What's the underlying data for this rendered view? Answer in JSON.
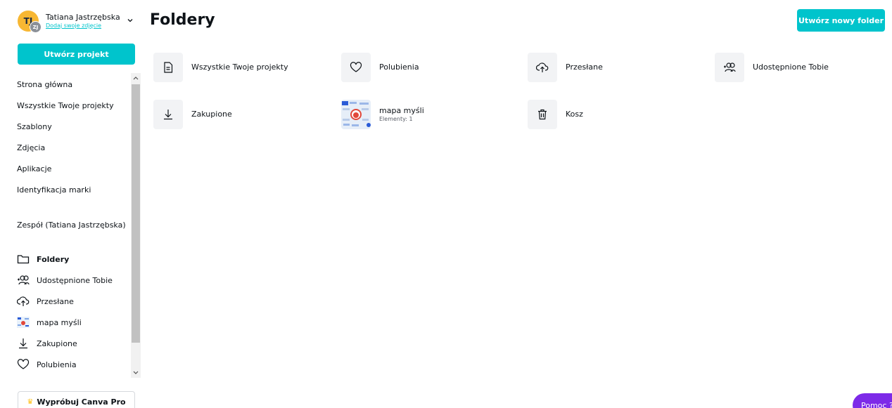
{
  "user": {
    "name": "Tatiana Jastrzębska",
    "add_photo_link": "Dodaj swoje zdjęcie",
    "avatar_initials": "TJ",
    "team_badge": "ZJ",
    "avatar_color": "#f7b733"
  },
  "sidebar": {
    "create_button": "Utwórz projekt",
    "items": [
      {
        "label": "Strona główna"
      },
      {
        "label": "Wszystkie Twoje projekty"
      },
      {
        "label": "Szablony"
      },
      {
        "label": "Zdjęcia"
      },
      {
        "label": "Aplikacje"
      },
      {
        "label": "Identyfikacja marki"
      },
      {
        "label": "Zespół (Tatiana Jastrzębska)"
      }
    ],
    "folders": [
      {
        "label": "Foldery",
        "icon": "folder-icon",
        "active": true
      },
      {
        "label": "Udostępnione Tobie",
        "icon": "shared-users-icon"
      },
      {
        "label": "Przesłane",
        "icon": "cloud-upload-icon"
      },
      {
        "label": "mapa myśli",
        "icon": "mind-map-thumbnail"
      },
      {
        "label": "Zakupione",
        "icon": "download-icon"
      },
      {
        "label": "Polubienia",
        "icon": "heart-icon"
      }
    ],
    "pro_button": "Wypróbuj Canva Pro"
  },
  "main": {
    "title": "Foldery",
    "new_folder_button": "Utwórz nowy folder",
    "folders": [
      {
        "name": "Wszystkie Twoje projekty",
        "icon": "document-icon"
      },
      {
        "name": "Polubienia",
        "icon": "heart-icon"
      },
      {
        "name": "Przesłane",
        "icon": "cloud-upload-icon"
      },
      {
        "name": "Udostępnione Tobie",
        "icon": "shared-users-icon"
      },
      {
        "name": "Zakupione",
        "icon": "download-icon"
      },
      {
        "name": "mapa myśli",
        "subtitle": "Elementy: 1",
        "icon": "mind-map-thumbnail"
      },
      {
        "name": "Kosz",
        "icon": "trash-icon"
      }
    ]
  },
  "help_button": "Pomoc ?",
  "colors": {
    "accent": "#00c4cc",
    "help": "#7d2ae8",
    "tile_bg": "#f2f3f5"
  }
}
